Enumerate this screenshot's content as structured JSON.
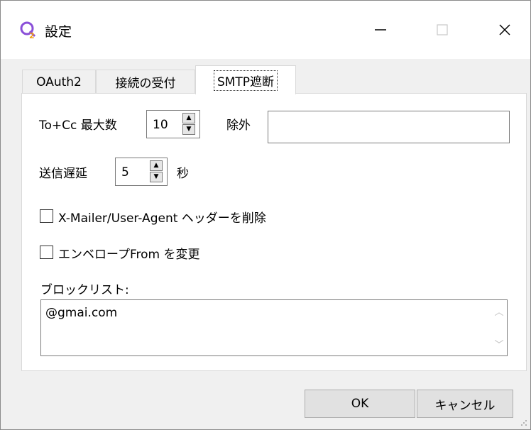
{
  "window": {
    "title": "設定",
    "app_icon": "app-logo-icon",
    "controls": {
      "minimize": "minimize-icon",
      "maximize": "maximize-icon",
      "close": "close-icon"
    }
  },
  "tabs": [
    {
      "label": "OAuth2",
      "selected": false
    },
    {
      "label": "接続の受付",
      "selected": false
    },
    {
      "label": "SMTP遮断",
      "selected": true
    }
  ],
  "smtp": {
    "recipients_label": "To+Cc 最大数",
    "recipients_value": "10",
    "exclude_label": "除外",
    "exclude_value": "",
    "delay_label": "送信遅延",
    "delay_value": "5",
    "delay_unit": "秒",
    "remove_headers_label": "X-Mailer/User-Agent ヘッダーを削除",
    "remove_headers_checked": false,
    "change_envelope_label": "エンベロープFrom を変更",
    "change_envelope_checked": false,
    "blocklist_label": "ブロックリスト:",
    "blocklist_value": "@gmai.com"
  },
  "buttons": {
    "ok": "OK",
    "cancel": "キャンセル"
  },
  "colors": {
    "window_bg": "#f0f0f0",
    "panel_bg": "#ffffff",
    "icon_purple": "#8a4fd8",
    "icon_orange": "#f39c12"
  }
}
